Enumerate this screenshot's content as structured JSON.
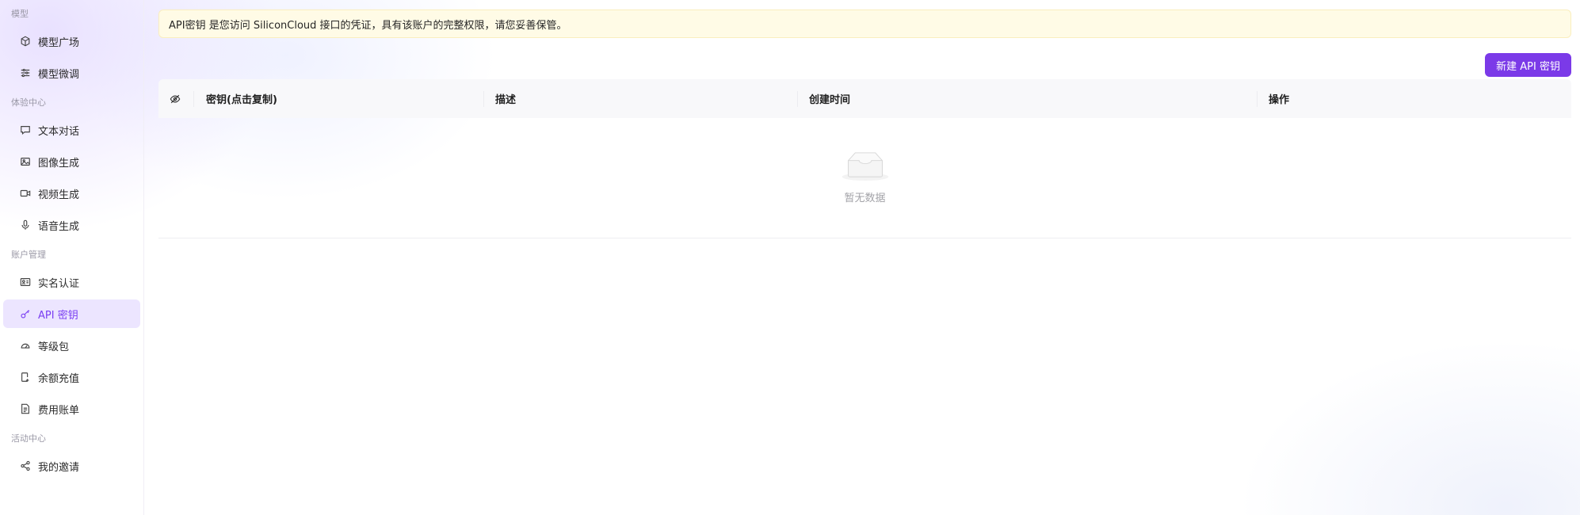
{
  "sidebar": {
    "sections": [
      {
        "title": "模型",
        "items": [
          {
            "label": "模型广场",
            "icon": "cube-icon"
          },
          {
            "label": "模型微调",
            "icon": "sliders-icon"
          }
        ]
      },
      {
        "title": "体验中心",
        "items": [
          {
            "label": "文本对话",
            "icon": "chat-bubble-icon"
          },
          {
            "label": "图像生成",
            "icon": "image-icon"
          },
          {
            "label": "视频生成",
            "icon": "video-camera-icon"
          },
          {
            "label": "语音生成",
            "icon": "microphone-icon"
          }
        ]
      },
      {
        "title": "账户管理",
        "items": [
          {
            "label": "实名认证",
            "icon": "id-card-icon"
          },
          {
            "label": "API 密钥",
            "icon": "key-icon",
            "active": true
          },
          {
            "label": "等级包",
            "icon": "gauge-icon"
          },
          {
            "label": "余额充值",
            "icon": "wallet-phone-icon"
          },
          {
            "label": "费用账单",
            "icon": "bill-icon"
          }
        ]
      },
      {
        "title": "活动中心",
        "items": [
          {
            "label": "我的邀请",
            "icon": "share-icon"
          }
        ]
      }
    ]
  },
  "notice": {
    "text": "API密钥 是您访问 SiliconCloud 接口的凭证，具有该账户的完整权限，请您妥善保管。"
  },
  "toolbar": {
    "create_label": "新建 API 密钥"
  },
  "table": {
    "toggle_icon": "eye-slash-icon",
    "columns": [
      "密钥(点击复制)",
      "描述",
      "创建时间",
      "操作"
    ],
    "rows": [],
    "empty_text": "暂无数据"
  },
  "colors": {
    "accent": "#7b3ae8",
    "notice_bg": "#fffbe6",
    "active_bg": "#e6dbff"
  }
}
